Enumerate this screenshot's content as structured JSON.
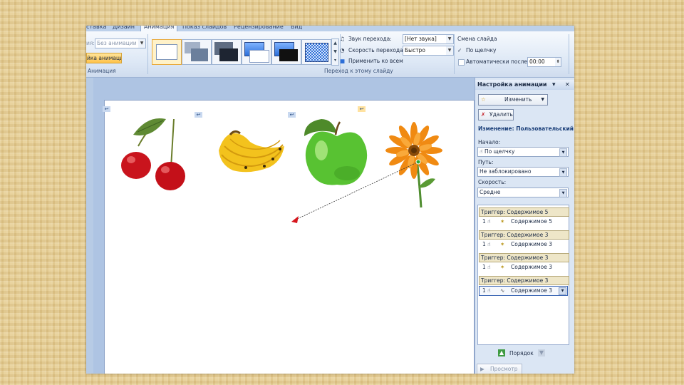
{
  "tabs": [
    "ставка",
    "Дизайн",
    "Анимация",
    "Показ слайдов",
    "Рецензирование",
    "Вид"
  ],
  "ribbon": {
    "anim_label": "ия:",
    "anim_combo": "Без анимации",
    "anim_button": "йка анимации",
    "anim_group": "Анимация",
    "sound_label": "Звук перехода:",
    "sound_value": "[Нет звука]",
    "speed_label": "Скорость перехода:",
    "speed_value": "Быстро",
    "apply_all": "Применить ко всем",
    "transition_group": "Переход к этому слайду",
    "advance_title": "Смена слайда",
    "on_click": "По щелчку",
    "auto_after": "Автоматически после:",
    "auto_time": "00:00"
  },
  "pane": {
    "title": "Настройка анимации",
    "change_button": "Изменить",
    "remove_button": "Удалить",
    "change_info": "Изменение: Пользовательский",
    "start_label": "Начало:",
    "start_value": "По щелчку",
    "path_label": "Путь:",
    "path_value": "Не заблокировано",
    "speed_label": "Скорость:",
    "speed_value": "Средне",
    "list": [
      {
        "trigger": "Триггер: Содержимое 5",
        "num": "1",
        "label": "Содержимое 5"
      },
      {
        "trigger": "Триггер: Содержимое 3",
        "num": "1",
        "label": "Содержимое 3"
      },
      {
        "trigger": "Триггер: Содержимое 3",
        "num": "1",
        "label": "Содержимое 3"
      },
      {
        "trigger": "Триггер: Содержимое 3",
        "num": "1",
        "label": "Содержимое 3"
      }
    ],
    "order_label": "Порядок",
    "preview_button": "Просмотр"
  },
  "colors": {
    "accent": "#ffc24a",
    "pane_bg": "#dbe6f4",
    "trigger_bg": "#eee6c8"
  }
}
